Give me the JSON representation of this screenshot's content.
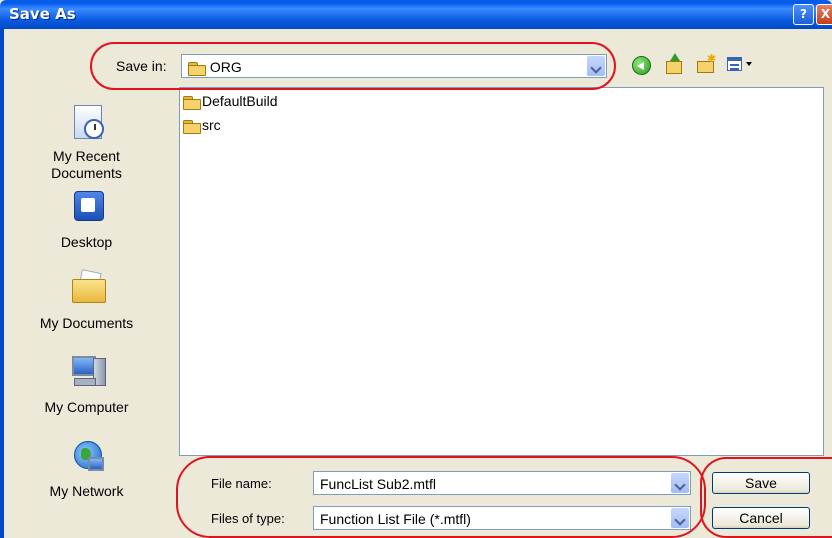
{
  "window": {
    "title": "Save As",
    "help_glyph": "?",
    "close_glyph": "X"
  },
  "save_in": {
    "label": "Save in:",
    "value": "ORG"
  },
  "toolbar": {
    "back_icon": "back-icon",
    "up_icon": "up-folder-icon",
    "new_folder_icon": "new-folder-icon",
    "views_icon": "views-menu-icon"
  },
  "places": [
    {
      "label_line1": "My Recent",
      "label_line2": "Documents",
      "icon": "recent-documents-icon"
    },
    {
      "label_line1": "Desktop",
      "icon": "desktop-icon"
    },
    {
      "label_line1": "My Documents",
      "icon": "my-documents-icon"
    },
    {
      "label_line1": "My Computer",
      "icon": "my-computer-icon"
    },
    {
      "label_line1": "My Network",
      "icon": "my-network-icon"
    }
  ],
  "files": [
    {
      "name": "DefaultBuild",
      "type": "folder"
    },
    {
      "name": "src",
      "type": "folder"
    }
  ],
  "file_name": {
    "label": "File name:",
    "value": "FuncList Sub2.mtfl"
  },
  "file_type": {
    "label": "Files of type:",
    "value": "Function List File (*.mtfl)"
  },
  "buttons": {
    "save": "Save",
    "cancel": "Cancel"
  },
  "colors": {
    "highlight": "#e0141e",
    "titlebar": "#0058ee",
    "dialog": "#ece9d8"
  }
}
